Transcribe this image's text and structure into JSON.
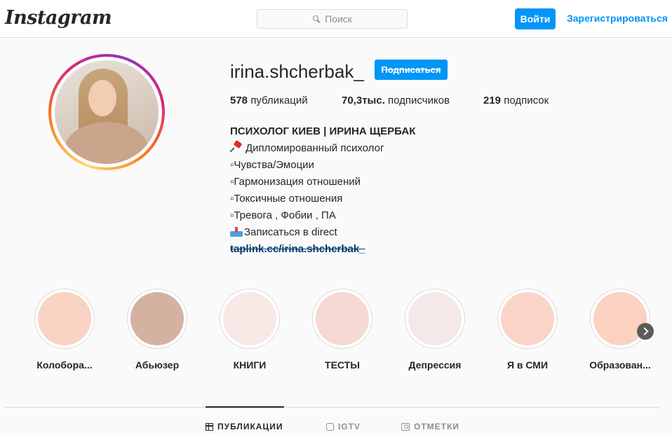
{
  "header": {
    "logo": "Instagram",
    "search_placeholder": "Поиск",
    "login_label": "Войти",
    "signup_label": "Зарегистрироваться"
  },
  "profile": {
    "username": "irina.shcherbak_",
    "follow_label": "Подписаться",
    "stats": {
      "posts_count": "578",
      "posts_label": "публикаций",
      "followers_count": "70,3тыс.",
      "followers_label": "подписчиков",
      "following_count": "219",
      "following_label": "подписок"
    },
    "bio": {
      "name": "ПСИХОЛОГ КИЕВ | ИРИНА ЩЕРБАК",
      "lines": [
        "Дипломированный психолог",
        "▫Чувства/Эмоции",
        "▫Гармонизация отношений",
        "▫Токсичные отношения",
        "▫Тревога , Фобии , ПА",
        "Записаться в direct"
      ],
      "link": "taplink.cc/irina.shcherbak_"
    }
  },
  "highlights": [
    {
      "label": "Колобора...",
      "color": "#f9d3c3"
    },
    {
      "label": "Абьюзер",
      "color": "#d4b2a2"
    },
    {
      "label": "КНИГИ",
      "color": "#f6e9e6"
    },
    {
      "label": "ТЕСТЫ",
      "color": "#f6d9d2"
    },
    {
      "label": "Депрессия",
      "color": "#f5e8e8"
    },
    {
      "label": "Я в СМИ",
      "color": "#fad4c7"
    },
    {
      "label": "Образован...",
      "color": "#fbd1c0"
    }
  ],
  "tabs": [
    {
      "label": "ПУБЛИКАЦИИ",
      "icon": "grid-icon"
    },
    {
      "label": "IGTV",
      "icon": "igtv-icon"
    },
    {
      "label": "ОТМЕТКИ",
      "icon": "tagged-icon"
    }
  ],
  "colors": {
    "accent": "#0095f6",
    "link": "#00376b",
    "text": "#262626",
    "muted": "#8e8e8e"
  }
}
